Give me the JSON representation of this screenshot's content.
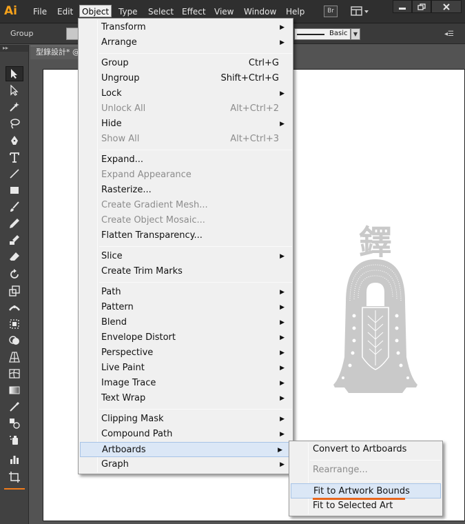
{
  "app": {
    "logo": "Ai"
  },
  "menubar": {
    "items": [
      "File",
      "Edit",
      "Object",
      "Type",
      "Select",
      "Effect",
      "View",
      "Window",
      "Help"
    ],
    "active": "Object",
    "bridge_button": "Br"
  },
  "controlbar": {
    "selection_label": "Group",
    "stroke_profile": "Basic"
  },
  "document": {
    "tab_title": "型錄設計* @"
  },
  "object_menu": {
    "items": [
      {
        "label": "Transform",
        "submenu": true
      },
      {
        "label": "Arrange",
        "submenu": true
      },
      {
        "label": "Group",
        "shortcut": "Ctrl+G"
      },
      {
        "label": "Ungroup",
        "shortcut": "Shift+Ctrl+G"
      },
      {
        "label": "Lock",
        "submenu": true
      },
      {
        "label": "Unlock All",
        "shortcut": "Alt+Ctrl+2",
        "disabled": true
      },
      {
        "label": "Hide",
        "submenu": true
      },
      {
        "label": "Show All",
        "shortcut": "Alt+Ctrl+3",
        "disabled": true
      },
      {
        "label": "Expand..."
      },
      {
        "label": "Expand Appearance",
        "disabled": true
      },
      {
        "label": "Rasterize..."
      },
      {
        "label": "Create Gradient Mesh...",
        "disabled": true
      },
      {
        "label": "Create Object Mosaic...",
        "disabled": true
      },
      {
        "label": "Flatten Transparency..."
      },
      {
        "label": "Slice",
        "submenu": true
      },
      {
        "label": "Create Trim Marks"
      },
      {
        "label": "Path",
        "submenu": true
      },
      {
        "label": "Pattern",
        "submenu": true
      },
      {
        "label": "Blend",
        "submenu": true
      },
      {
        "label": "Envelope Distort",
        "submenu": true
      },
      {
        "label": "Perspective",
        "submenu": true
      },
      {
        "label": "Live Paint",
        "submenu": true
      },
      {
        "label": "Image Trace",
        "submenu": true
      },
      {
        "label": "Text Wrap",
        "submenu": true
      },
      {
        "label": "Clipping Mask",
        "submenu": true
      },
      {
        "label": "Compound Path",
        "submenu": true
      },
      {
        "label": "Artboards",
        "submenu": true,
        "highlighted": true
      },
      {
        "label": "Graph",
        "submenu": true
      }
    ]
  },
  "artboards_submenu": {
    "items": [
      {
        "label": "Convert to Artboards"
      },
      {
        "label": "Rearrange...",
        "disabled": true
      },
      {
        "label": "Fit to Artwork Bounds",
        "highlighted": true
      },
      {
        "label": "Fit to Selected Art"
      }
    ]
  },
  "artwork": {
    "glyph": "鐸"
  },
  "colors": {
    "accent": "#f27c1b",
    "menu_bg": "#f0f0f0",
    "highlight": "#dbe7f6",
    "artwork_gray": "#c9c9c9"
  },
  "tools": [
    "selection-tool",
    "direct-selection-tool",
    "magic-wand-tool",
    "lasso-tool",
    "pen-tool",
    "type-tool",
    "line-tool",
    "rectangle-tool",
    "paintbrush-tool",
    "pencil-tool",
    "blob-brush-tool",
    "eraser-tool",
    "rotate-tool",
    "scale-tool",
    "width-tool",
    "free-transform-tool",
    "shape-builder-tool",
    "perspective-grid-tool",
    "mesh-tool",
    "gradient-tool",
    "eyedropper-tool",
    "blend-tool",
    "symbol-sprayer-tool",
    "column-graph-tool",
    "artboard-tool"
  ]
}
